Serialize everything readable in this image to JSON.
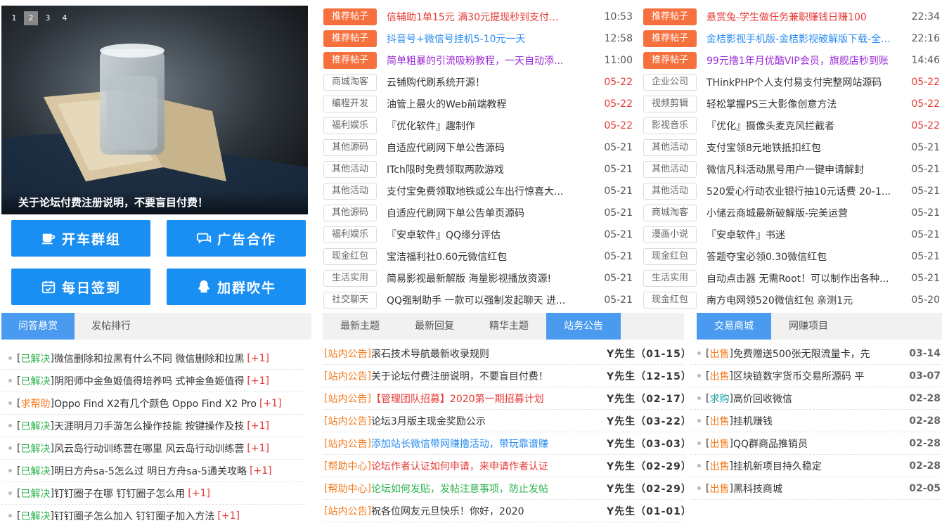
{
  "slider": {
    "pages": [
      "1",
      "2",
      "3",
      "4"
    ],
    "active_page": "2",
    "caption": "关于论坛付费注册说明，不要盲目付费！"
  },
  "buttons": [
    {
      "label": "开车群组",
      "icon": "cup-icon"
    },
    {
      "label": "广告合作",
      "icon": "chat-icon"
    },
    {
      "label": "每日签到",
      "icon": "calendar-check-icon"
    },
    {
      "label": "加群吹牛",
      "icon": "qq-penguin-icon"
    }
  ],
  "hot_left": [
    {
      "tag": "推荐帖子",
      "rec": true,
      "title": "信辅助1单15元 满30元提现秒到支付...",
      "date": "10:53",
      "color": "#e53935",
      "hot": false
    },
    {
      "tag": "推荐帖子",
      "rec": true,
      "title": "抖音号+微信号挂机5-10元一天",
      "date": "12:58",
      "color": "#2a8cf0",
      "hot": false
    },
    {
      "tag": "推荐帖子",
      "rec": true,
      "title": "简单粗暴的引流吸粉教程，一天自动添...",
      "date": "11:00",
      "color": "#9b2bd6",
      "hot": false
    },
    {
      "tag": "商城淘客",
      "rec": false,
      "title": "云铺购代刷系统开源！",
      "date": "05-22",
      "color": "#333333",
      "hot": true
    },
    {
      "tag": "编程开发",
      "rec": false,
      "title": "油管上最火的Web前端教程",
      "date": "05-22",
      "color": "#333333",
      "hot": true
    },
    {
      "tag": "福利娱乐",
      "rec": false,
      "title": "『优化软件』趣制作",
      "date": "05-22",
      "color": "#333333",
      "hot": true
    },
    {
      "tag": "其他源码",
      "rec": false,
      "title": "自适应代刷网下单公告源码",
      "date": "05-21",
      "color": "#333333",
      "hot": false
    },
    {
      "tag": "其他活动",
      "rec": false,
      "title": "ITch限时免费领取两款游戏",
      "date": "05-21",
      "color": "#333333",
      "hot": false
    },
    {
      "tag": "其他活动",
      "rec": false,
      "title": "支付宝免费领取地铁或公车出行惊喜大...",
      "date": "05-21",
      "color": "#333333",
      "hot": false
    },
    {
      "tag": "其他源码",
      "rec": false,
      "title": "自适应代刷网下单公告单页源码",
      "date": "05-21",
      "color": "#333333",
      "hot": false
    },
    {
      "tag": "福利娱乐",
      "rec": false,
      "title": "『安卓软件』QQ缘分评估",
      "date": "05-21",
      "color": "#333333",
      "hot": false
    },
    {
      "tag": "现金红包",
      "rec": false,
      "title": "宝洁福利社0.60元微信红包",
      "date": "05-21",
      "color": "#333333",
      "hot": false
    },
    {
      "tag": "生活实用",
      "rec": false,
      "title": "简易影视最新解版 海量影视播放资源!",
      "date": "05-21",
      "color": "#333333",
      "hot": false
    },
    {
      "tag": "社交聊天",
      "rec": false,
      "title": "QQ强制助手 一款可以强制发起聊天 进...",
      "date": "05-21",
      "color": "#333333",
      "hot": false
    }
  ],
  "hot_right": [
    {
      "tag": "推荐帖子",
      "rec": true,
      "title": "悬赏兔-学生做任务兼职赚钱日赚100",
      "date": "22:34",
      "color": "#e53935",
      "hot": false
    },
    {
      "tag": "推荐帖子",
      "rec": true,
      "title": "金桔影视手机版-金桔影视破解版下载-全...",
      "date": "22:16",
      "color": "#2a8cf0",
      "hot": false
    },
    {
      "tag": "推荐帖子",
      "rec": true,
      "title": "99元撸1年月优酷VIP会员，旗舰店秒到账",
      "date": "14:46",
      "color": "#9b2bd6",
      "hot": false
    },
    {
      "tag": "企业公司",
      "rec": false,
      "title": "THinkPHP个人支付易支付完整网站源码",
      "date": "05-22",
      "color": "#333333",
      "hot": true
    },
    {
      "tag": "视频剪辑",
      "rec": false,
      "title": "轻松掌握PS三大影像创意方法",
      "date": "05-22",
      "color": "#333333",
      "hot": true
    },
    {
      "tag": "影视音乐",
      "rec": false,
      "title": "『优化』摄像头麦克风拦截者",
      "date": "05-22",
      "color": "#333333",
      "hot": true
    },
    {
      "tag": "其他活动",
      "rec": false,
      "title": "支付宝领8元地铁抵扣红包",
      "date": "05-21",
      "color": "#333333",
      "hot": false
    },
    {
      "tag": "其他活动",
      "rec": false,
      "title": "微信凡科活动黑号用户一键申请解封",
      "date": "05-21",
      "color": "#333333",
      "hot": false
    },
    {
      "tag": "其他活动",
      "rec": false,
      "title": "520爱心行动农业银行抽10元话费 20-1...",
      "date": "05-21",
      "color": "#333333",
      "hot": false
    },
    {
      "tag": "商城淘客",
      "rec": false,
      "title": "小储云商城最新破解版-完美运营",
      "date": "05-21",
      "color": "#333333",
      "hot": false
    },
    {
      "tag": "漫画小说",
      "rec": false,
      "title": "『安卓软件』书迷",
      "date": "05-21",
      "color": "#333333",
      "hot": false
    },
    {
      "tag": "现金红包",
      "rec": false,
      "title": "答题夺宝必领0.30微信红包",
      "date": "05-21",
      "color": "#333333",
      "hot": false
    },
    {
      "tag": "生活实用",
      "rec": false,
      "title": "自动点击器 无需Root！可以制作出各种...",
      "date": "05-21",
      "color": "#333333",
      "hot": false
    },
    {
      "tag": "现金红包",
      "rec": false,
      "title": "南方电网领520微信红包 亲测1元",
      "date": "05-20",
      "color": "#333333",
      "hot": false
    }
  ],
  "qa_tabs": [
    "问答悬赏",
    "发帖排行"
  ],
  "qa_items": [
    {
      "status": "已解决",
      "kind": "green",
      "text": "微信删除和拉黑有什么不同 微信删除和拉黑",
      "plus": "[+1]"
    },
    {
      "status": "已解决",
      "kind": "green",
      "text": "阴阳师中金鱼姬值得培养吗 式神金鱼姬值得",
      "plus": "[+1]"
    },
    {
      "status": "求帮助",
      "kind": "orange",
      "text": "Oppo Find X2有几个颜色 Oppo Find X2 Pro",
      "plus": "[+1]"
    },
    {
      "status": "已解决",
      "kind": "green",
      "text": "天涯明月刀手游怎么操作技能 按键操作及技",
      "plus": "[+1]"
    },
    {
      "status": "已解决",
      "kind": "green",
      "text": "风云岛行动训练营在哪里 风云岛行动训练营",
      "plus": "[+1]"
    },
    {
      "status": "已解决",
      "kind": "green",
      "text": "明日方舟sa-5怎么过 明日方舟sa-5通关攻略",
      "plus": "[+1]"
    },
    {
      "status": "已解决",
      "kind": "green",
      "text": "钉钉圈子在哪 钉钉圈子怎么用",
      "plus": "[+1]"
    },
    {
      "status": "已解决",
      "kind": "green",
      "text": "钉钉圈子怎么加入 钉钉圈子加入方法",
      "plus": "[+1]"
    }
  ],
  "mid_tabs": [
    "最新主题",
    "最新回复",
    "精华主题",
    "站务公告"
  ],
  "mid_active": 3,
  "announcements": [
    {
      "cat": "站内公告",
      "title": "滚石技术导航最新收录规则",
      "color": "#333333",
      "who": "Y先生（01-15）"
    },
    {
      "cat": "站内公告",
      "title": "关于论坛付费注册说明，不要盲目付费！",
      "color": "#333333",
      "who": "Y先生（12-15）"
    },
    {
      "cat": "站内公告",
      "title": "【管理团队招募】2020第一期招募计划",
      "color": "#e53935",
      "who": "Y先生（02-17）"
    },
    {
      "cat": "站内公告",
      "title": "论坛3月版主现金奖励公示",
      "color": "#333333",
      "who": "Y先生（03-22）"
    },
    {
      "cat": "站内公告",
      "title": "添加站长微信带网赚撸活动，带玩靠谱赚",
      "color": "#2a8cf0",
      "who": "Y先生（03-03）"
    },
    {
      "cat": "帮助中心",
      "title": "论坛作者认证如何申请，来申请作者认证",
      "color": "#e53935",
      "who": "Y先生（02-29）"
    },
    {
      "cat": "帮助中心",
      "title": "论坛如何发贴，发帖注意事项，防止发帖",
      "color": "#2bb24c",
      "who": "Y先生（02-29）"
    },
    {
      "cat": "站内公告",
      "title": "祝各位网友元旦快乐！你好，2020",
      "color": "#333333",
      "who": "Y先生（01-01）"
    }
  ],
  "trade_tabs": [
    "交易商城",
    "网赚项目"
  ],
  "trade_items": [
    {
      "status": "出售",
      "kind": "orange",
      "text": "免费赠送500张无限流量卡，先",
      "date": "03-14"
    },
    {
      "status": "出售",
      "kind": "orange",
      "text": "区块链数字货币交易所源码 平",
      "date": "03-07"
    },
    {
      "status": "求购",
      "kind": "teal",
      "text": "高价回收微信",
      "date": "02-28"
    },
    {
      "status": "出售",
      "kind": "orange",
      "text": "挂机赚钱",
      "date": "02-28"
    },
    {
      "status": "出售",
      "kind": "orange",
      "text": "QQ群商品推销员",
      "date": "02-28"
    },
    {
      "status": "出售",
      "kind": "orange",
      "text": "挂机新项目持久稳定",
      "date": "02-28"
    },
    {
      "status": "出售",
      "kind": "orange",
      "text": "黑科技商城",
      "date": "02-05"
    }
  ]
}
